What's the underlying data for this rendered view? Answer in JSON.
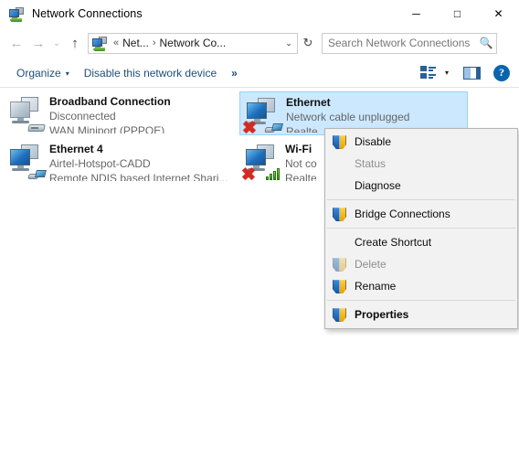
{
  "window": {
    "title": "Network Connections",
    "icon": "network-connections-icon",
    "controls": {
      "minimize": "─",
      "maximize": "□",
      "close": "✕"
    }
  },
  "navbar": {
    "back": "←",
    "forward": "→",
    "recent": "⌄",
    "up": "↑",
    "address": {
      "icon": "network-connections-icon",
      "chevrons": "«",
      "crumbs": [
        "Net...",
        "Network Co..."
      ],
      "separator": "›",
      "dropdown": "⌄"
    },
    "refresh": "↻",
    "search": {
      "placeholder": "Search Network Connections",
      "value": "",
      "icon": "search-icon"
    }
  },
  "toolbar": {
    "organize_label": "Organize",
    "organize_caret": "▾",
    "disable_label": "Disable this network device",
    "overflow_label": "»",
    "view_caret": "▾",
    "help_label": "?"
  },
  "connections": [
    {
      "name": "Broadband Connection",
      "status": "Disconnected",
      "device": "WAN Miniport (PPPOE)",
      "icon": "computer-disconnected-icon",
      "badge": "modem-icon",
      "error": false,
      "active": false,
      "selected": false
    },
    {
      "name": "Ethernet",
      "status": "Network cable unplugged",
      "device": "Realte",
      "icon": "computer-icon",
      "badge": "rj45-icon",
      "error": true,
      "active": true,
      "selected": true
    },
    {
      "name": "Ethernet 4",
      "status": "Airtel-Hotspot-CADD",
      "device": "Remote NDIS based Internet Shari...",
      "icon": "computer-icon",
      "badge": "rj45-icon",
      "error": false,
      "active": true,
      "selected": false
    },
    {
      "name": "Wi-Fi",
      "status": "Not co",
      "device": "Realte",
      "icon": "computer-icon",
      "badge": "signal-bars-icon",
      "error": true,
      "active": true,
      "selected": false
    }
  ],
  "context_menu": {
    "items": [
      {
        "label": "Disable",
        "shield": true,
        "disabled": false,
        "bold": false,
        "separator_after": false
      },
      {
        "label": "Status",
        "shield": false,
        "disabled": true,
        "bold": false,
        "separator_after": false
      },
      {
        "label": "Diagnose",
        "shield": false,
        "disabled": false,
        "bold": false,
        "separator_after": true
      },
      {
        "label": "Bridge Connections",
        "shield": true,
        "disabled": false,
        "bold": false,
        "separator_after": true
      },
      {
        "label": "Create Shortcut",
        "shield": false,
        "disabled": false,
        "bold": false,
        "separator_after": false
      },
      {
        "label": "Delete",
        "shield": true,
        "disabled": true,
        "bold": false,
        "separator_after": false
      },
      {
        "label": "Rename",
        "shield": true,
        "disabled": false,
        "bold": false,
        "separator_after": true
      },
      {
        "label": "Properties",
        "shield": true,
        "disabled": false,
        "bold": true,
        "separator_after": false
      }
    ]
  },
  "colors": {
    "selection_fill": "#cce8ff",
    "selection_border": "#99d1ff",
    "toolbar_link": "#1f4e79",
    "menu_background": "#f2f2f2",
    "error_x": "#d42a22",
    "help_blue": "#0a64ad"
  }
}
